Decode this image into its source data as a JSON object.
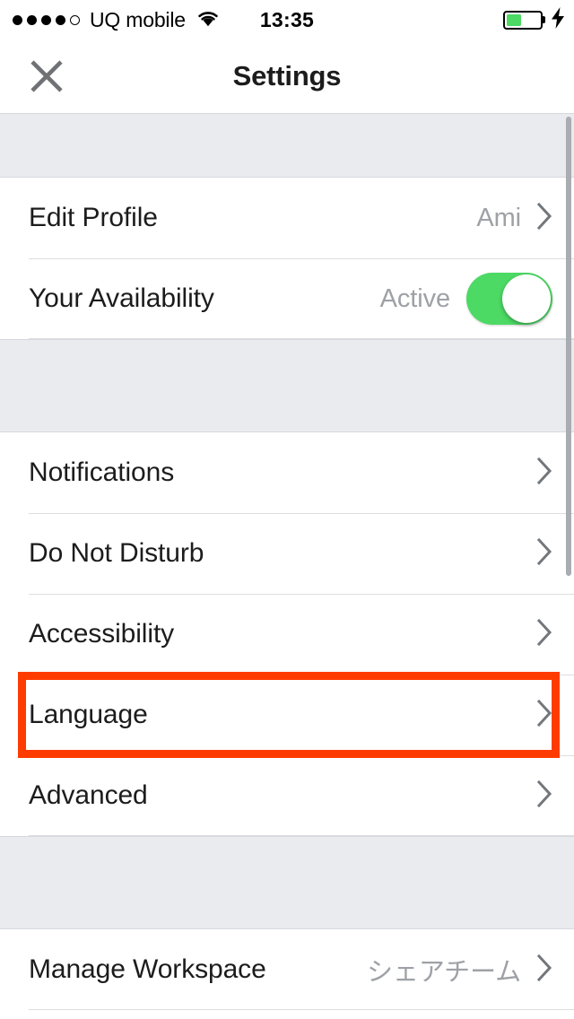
{
  "status_bar": {
    "carrier": "UQ mobile",
    "signal_dots_filled": 4,
    "signal_dots_total": 5,
    "wifi_icon": "wifi-icon",
    "time": "13:35",
    "battery_level_percent": 45,
    "battery_color": "#4CD964",
    "charging": true
  },
  "nav": {
    "close_icon": "close-x-icon",
    "title": "Settings"
  },
  "list": {
    "chevron_icon": "chevron-right-icon",
    "sections": [
      {
        "rows": [
          {
            "label": "Edit Profile",
            "value": "Ami",
            "accessory": "chevron"
          },
          {
            "label": "Your Availability",
            "value": "Active",
            "accessory": "toggle",
            "toggle_on": true
          }
        ]
      },
      {
        "rows": [
          {
            "label": "Notifications",
            "value": "",
            "accessory": "chevron"
          },
          {
            "label": "Do Not Disturb",
            "value": "",
            "accessory": "chevron"
          },
          {
            "label": "Accessibility",
            "value": "",
            "accessory": "chevron"
          },
          {
            "label": "Language",
            "value": "",
            "accessory": "chevron",
            "highlighted": true
          },
          {
            "label": "Advanced",
            "value": "",
            "accessory": "chevron"
          }
        ]
      },
      {
        "rows": [
          {
            "label": "Manage Workspace",
            "value": "シェアチーム",
            "accessory": "chevron"
          }
        ]
      }
    ]
  },
  "highlight": {
    "color": "#ff3c00",
    "target_row_label": "Language"
  },
  "scrollbar": {
    "color": "#a9acb1",
    "visible": true
  }
}
